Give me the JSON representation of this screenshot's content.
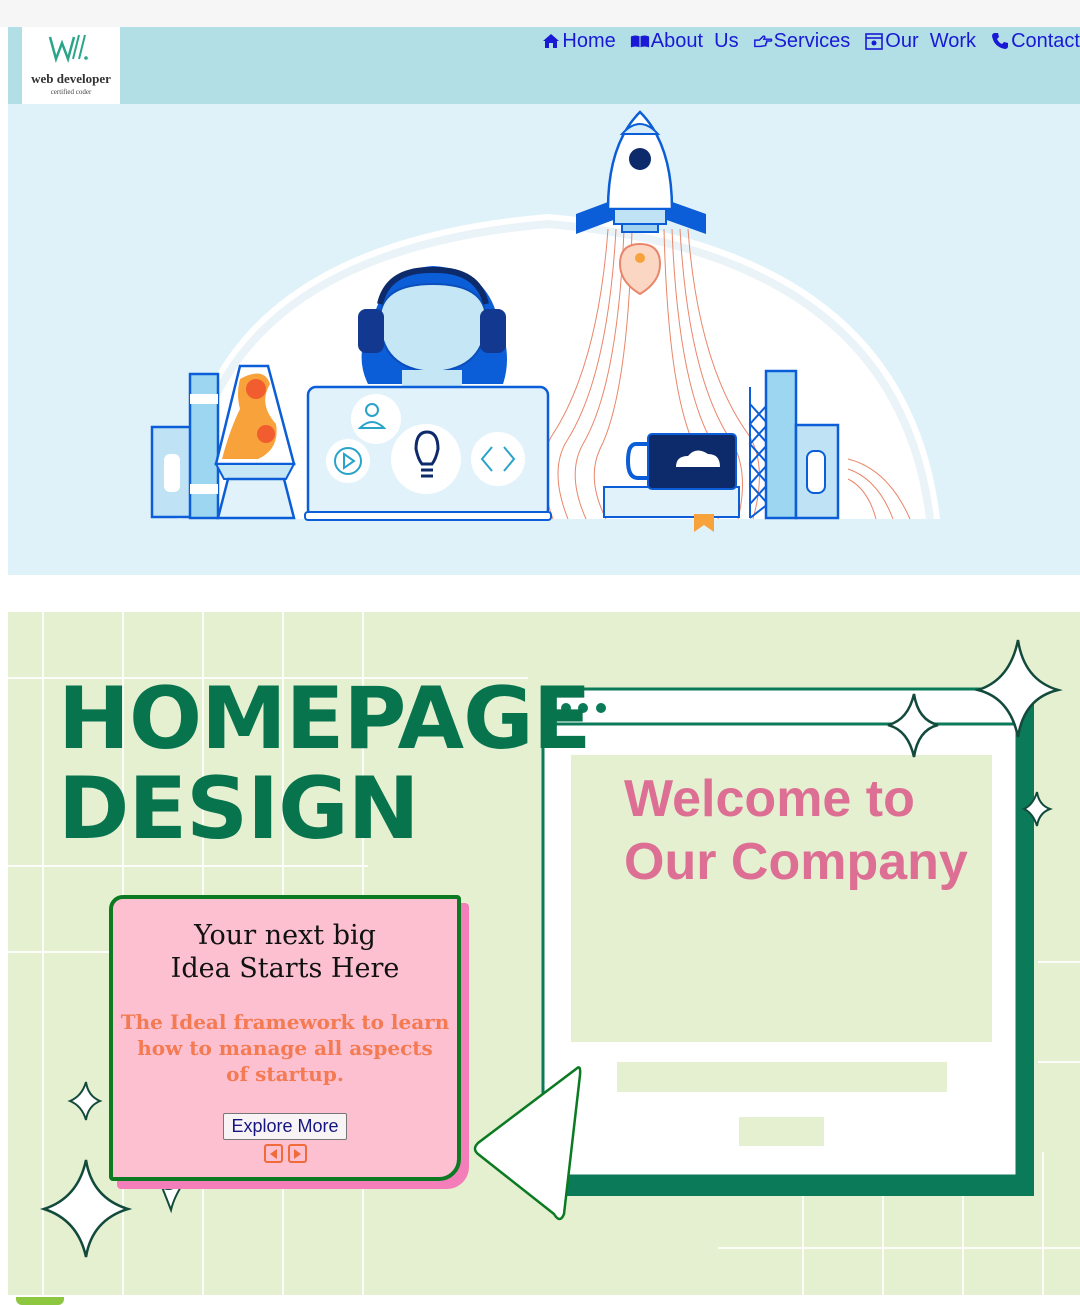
{
  "header": {
    "logo": {
      "mark": "W//.",
      "title": "web developer",
      "subtitle": "certified coder"
    },
    "nav": [
      {
        "icon": "home-icon",
        "label": "Home"
      },
      {
        "icon": "book-icon",
        "label": "About  Us"
      },
      {
        "icon": "hand-pointing-icon",
        "label": "Services"
      },
      {
        "icon": "briefcase-icon",
        "label": "Our  Work"
      },
      {
        "icon": "phone-icon",
        "label": "Contact"
      }
    ],
    "colors": {
      "bar": "#b1dfe5",
      "link": "#1919d6"
    }
  },
  "hero": {
    "colors": {
      "background": "#e0f2f9",
      "illustration_blue": "#0b5ed7"
    }
  },
  "banner": {
    "headline": [
      "HOMEPAGE",
      "DESIGN"
    ],
    "welcome": [
      "Welcome to",
      "Our Company"
    ],
    "card": {
      "title_lines": [
        "Your next big",
        "Idea Starts Here"
      ],
      "subtitle_lines": [
        "The Ideal framework to learn",
        "how to manage all aspects",
        "of startup."
      ],
      "button_label": "Explore More",
      "arrows": [
        "previous-arrow-icon",
        "next-arrow-icon"
      ]
    },
    "colors": {
      "background": "#e5f0d1",
      "headline": "#08744d",
      "welcome": "#dc6f93",
      "card": "#fcc0d0",
      "card_border": "#0b7a23",
      "card_shadow": "#f47eb9"
    }
  }
}
